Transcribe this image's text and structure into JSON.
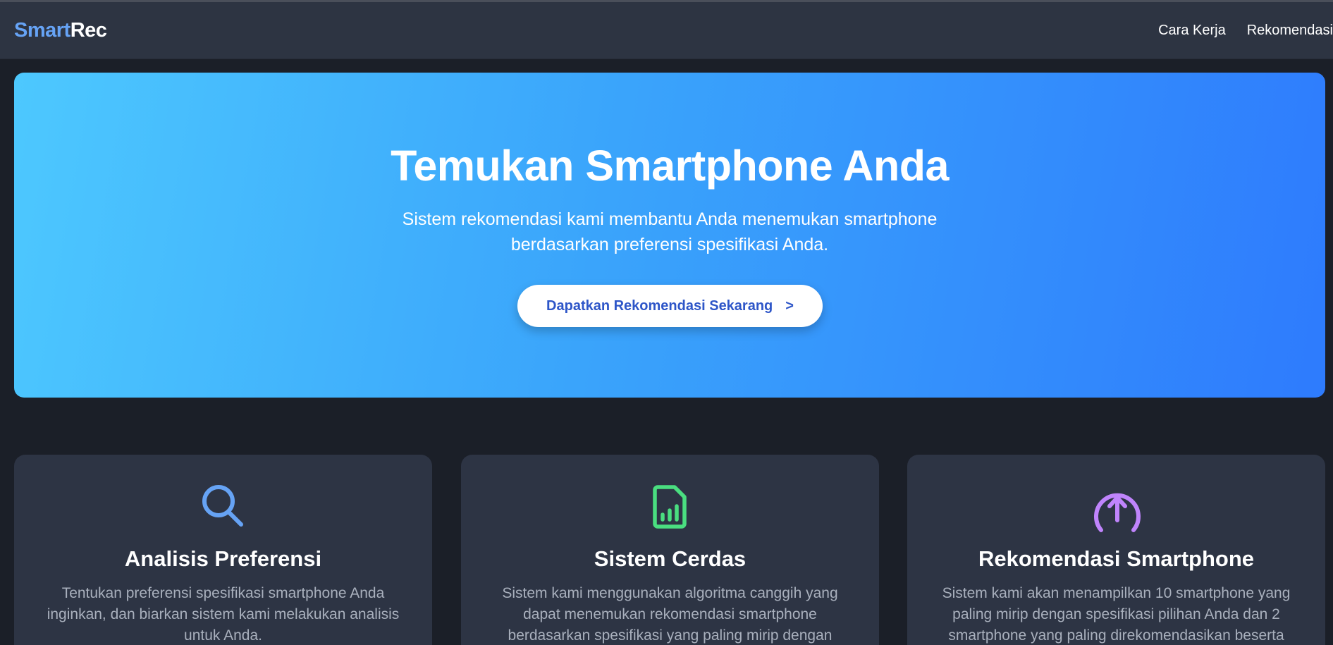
{
  "navbar": {
    "logo_part1": "Smart",
    "logo_part2": "Rec",
    "links": [
      "Cara Kerja",
      "Rekomendasi"
    ]
  },
  "hero": {
    "title": "Temukan Smartphone Anda",
    "subtitle_line1": "Sistem rekomendasi kami membantu Anda menemukan smartphone",
    "subtitle_line2": "berdasarkan preferensi spesifikasi Anda.",
    "button_label": "Dapatkan Rekomendasi Sekarang",
    "button_arrow": ">"
  },
  "features": [
    {
      "icon": "search-icon",
      "icon_color": "#66a3f5",
      "title": "Analisis Preferensi",
      "description": "Tentukan preferensi spesifikasi smartphone Anda inginkan, dan biarkan sistem kami melakukan analisis untuk Anda."
    },
    {
      "icon": "document-chart-icon",
      "icon_color": "#4ade80",
      "title": "Sistem Cerdas",
      "description": "Sistem kami menggunakan algoritma canggih yang dapat menemukan rekomendasi smartphone berdasarkan spesifikasi yang paling mirip dengan"
    },
    {
      "icon": "arrow-up-circle-icon",
      "icon_color": "#c084fc",
      "title": "Rekomendasi Smartphone",
      "description": "Sistem kami akan menampilkan 10 smartphone yang paling mirip dengan spesifikasi pilihan Anda dan 2 smartphone yang paling direkomendasikan beserta"
    }
  ]
}
